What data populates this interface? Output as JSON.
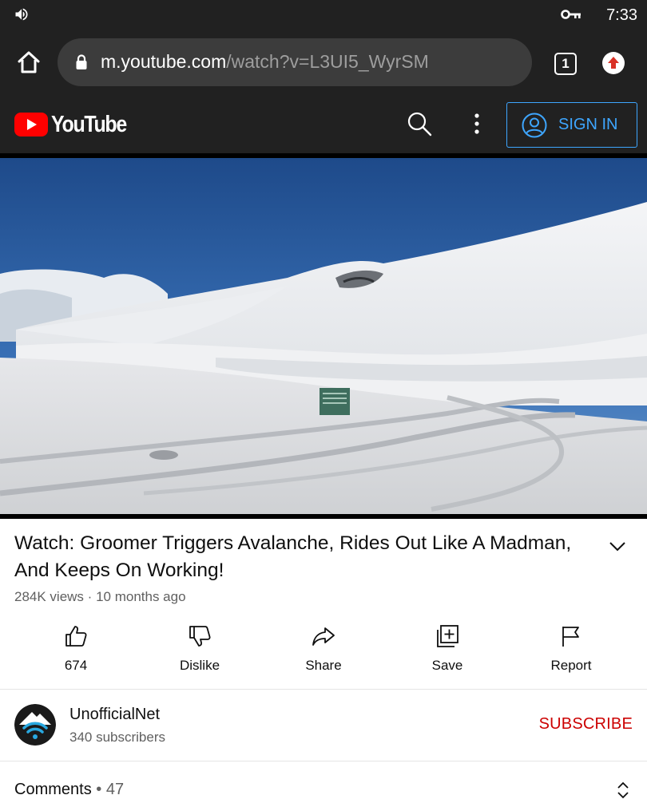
{
  "status_bar": {
    "time": "7:33",
    "icons": [
      "volume-icon",
      "vpn-key-icon"
    ]
  },
  "browser": {
    "url_host": "m.youtube.com",
    "url_path": "/watch?v=L3UI5_WyrSM",
    "tab_count": "1",
    "icons": [
      "home-icon",
      "lock-icon",
      "upload-icon"
    ]
  },
  "header": {
    "logo_text": "YouTube",
    "sign_in_label": "SIGN IN",
    "icons": [
      "search-icon",
      "more-vert-icon",
      "account-circle-icon"
    ],
    "colors": {
      "brand_red": "#ff0000",
      "accent_blue": "#3ea6ff"
    }
  },
  "video": {
    "title": "Watch: Groomer Triggers Avalanche, Rides Out Like A Madman, And Keeps On Working!",
    "views": "284K views",
    "separator": "·",
    "age": "10 months ago"
  },
  "actions": [
    {
      "label": "674",
      "icon": "like-icon"
    },
    {
      "label": "Dislike",
      "icon": "dislike-icon"
    },
    {
      "label": "Share",
      "icon": "share-icon"
    },
    {
      "label": "Save",
      "icon": "playlist-add-icon"
    },
    {
      "label": "Report",
      "icon": "flag-icon"
    }
  ],
  "channel": {
    "name": "UnofficialNet",
    "subscribers": "340 subscribers",
    "subscribe_label": "SUBSCRIBE",
    "subscribe_color": "#cc0000"
  },
  "comments": {
    "label": "Comments",
    "dot": "•",
    "count": "47"
  }
}
